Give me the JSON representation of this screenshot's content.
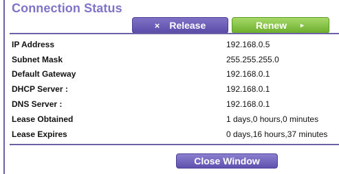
{
  "header": {
    "title": "Connection Status",
    "release_label": "Release",
    "renew_label": "Renew",
    "release_icon": "×",
    "renew_icon": "►"
  },
  "details": [
    {
      "label": "IP Address",
      "value": "192.168.0.5"
    },
    {
      "label": "Subnet Mask",
      "value": "255.255.255.0"
    },
    {
      "label": "Default Gateway",
      "value": "192.168.0.1"
    },
    {
      "label": "DHCP Server :",
      "value": "192.168.0.1"
    },
    {
      "label": "DNS Server :",
      "value": "192.168.0.1"
    },
    {
      "label": "Lease Obtained",
      "value": "1 days,0 hours,0 minutes"
    },
    {
      "label": "Lease Expires",
      "value": "0 days,16 hours,37 minutes"
    }
  ],
  "footer": {
    "close_label": "Close Window"
  },
  "colors": {
    "accent": "#7f73c8",
    "renew_green": "#6cae2d",
    "release_purple": "#5b4da8"
  }
}
